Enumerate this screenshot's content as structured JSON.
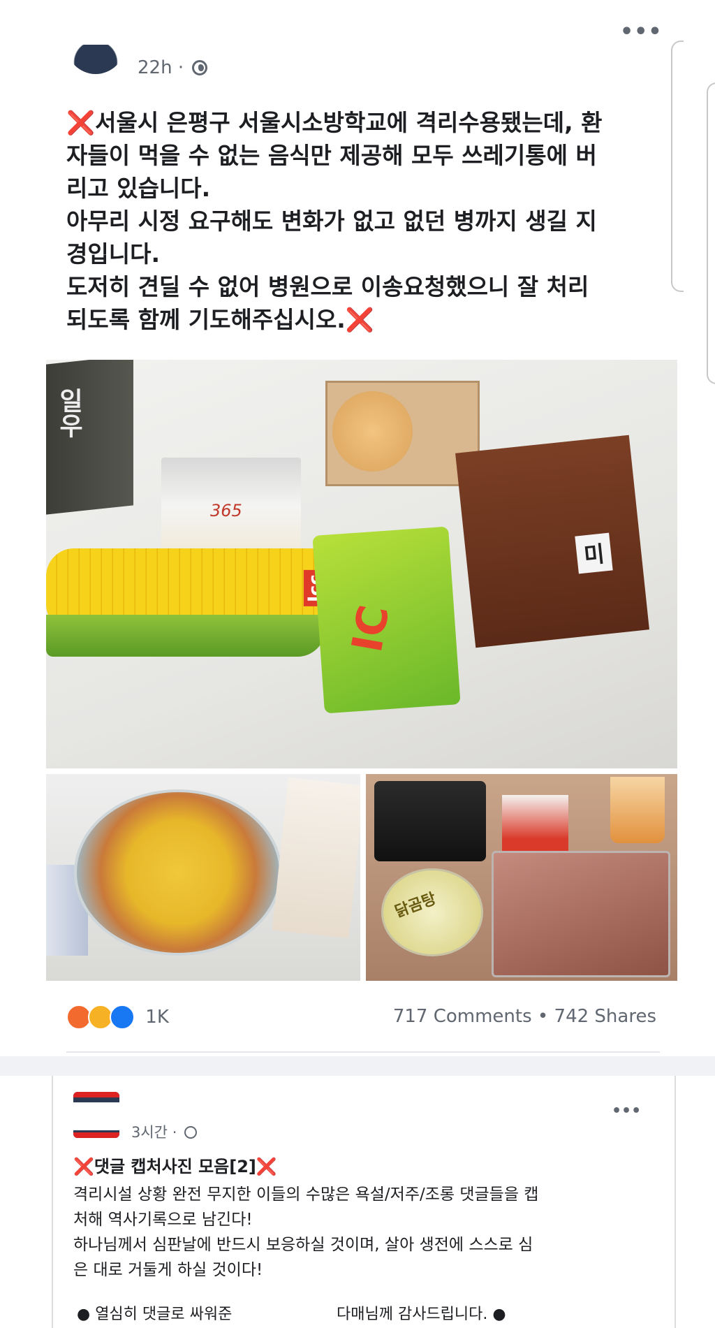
{
  "post": {
    "time": "22h",
    "separator": "·",
    "more": "•••",
    "text_line1": "서울시 은평구 서울시소방학교에 격리수용됐는데, 환",
    "text_line2": "자들이 먹을 수 없는 음식만 제공해 모두 쓰레기통에 버",
    "text_line3": "리고 있습니다.",
    "text_line4": "아무리 시정 요구해도 변화가 없고 없던 병까지 생길 지",
    "text_line5": "경입니다.",
    "text_line6": "도저히 견딜 수 없어 병원으로 이송요청했으니 잘 처리",
    "text_line7": "되도록 함께 기도해주십시오.",
    "x_mark": "❌",
    "reactions": [
      "angry",
      "haha",
      "like"
    ],
    "reaction_colors": [
      "#f26a2e",
      "#f7b125",
      "#1877f2"
    ],
    "reaction_count": "1K",
    "comments": "717 Comments",
    "shares": "742 Shares",
    "dot": "•"
  },
  "photo_texts": {
    "milk": "일우",
    "snack": "365",
    "corn_brand": "lcc",
    "package_green": "IC",
    "bread_label": "미",
    "bowl_label": "닭곰탕"
  },
  "comment_card": {
    "time": "3시간",
    "separator": "·",
    "more": "•••",
    "title": "댓글 캡처사진 모음[2]",
    "x_mark": "❌",
    "body_line1": "격리시설 상황 완전 무지한 이들의 수많은 욕설/저주/조롱 댓글들을 캡",
    "body_line2": "처해 역사기록으로 남긴다!",
    "body_line3": "하나님께서 심판날에 반드시 보응하실 것이며, 살아 생전에 스스로 심",
    "body_line4": "은 대로 거둘게 하실 것이다!",
    "footer_left": "● 열심히 댓글로 싸워준",
    "footer_right": "다매님께 감사드립니다. ●"
  }
}
